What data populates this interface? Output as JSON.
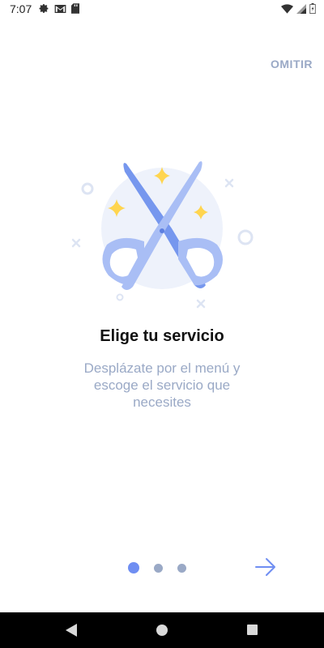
{
  "status_bar": {
    "time": "7:07",
    "left_icons": [
      "gear-icon",
      "gmail-icon",
      "sd-card-icon"
    ],
    "right_icons": [
      "wifi-icon",
      "signal-icon",
      "battery-icon"
    ]
  },
  "onboarding": {
    "skip_label": "OMITIR",
    "title": "Elige tu servicio",
    "description": "Desplázate por el menú y escoge el servicio que necesites",
    "illustration_icon": "scissors-icon",
    "pages_total": 3,
    "current_page": 1,
    "next_icon": "arrow-right-icon"
  },
  "colors": {
    "accent": "#6f8ef2",
    "muted": "#9aa9c6",
    "title": "#111111",
    "sparkle": "#ffd54f",
    "illustration_bg": "#eef2fb"
  },
  "nav_bar": {
    "icons": [
      "back-icon",
      "home-icon",
      "recents-icon"
    ]
  }
}
